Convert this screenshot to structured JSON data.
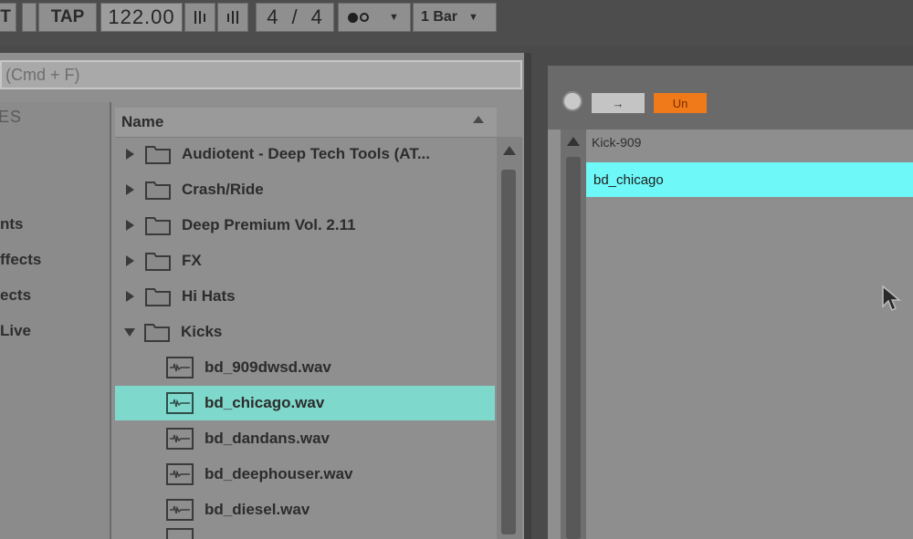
{
  "transport": {
    "first_label": "T",
    "tap_label": "TAP",
    "tempo": "122.00",
    "time_sig_num": "4",
    "time_sig_sep": "/",
    "time_sig_den": "4",
    "quantize": "1 Bar"
  },
  "browser": {
    "search_placeholder": "(Cmd + F)",
    "places": [
      {
        "label": "ES"
      },
      {
        "label": "nts"
      },
      {
        "label": "ffects"
      },
      {
        "label": "ects"
      },
      {
        "label": "Live"
      }
    ],
    "column_header": "Name",
    "rows": [
      {
        "type": "folder",
        "label": "Audiotent - Deep Tech Tools (AT...",
        "expanded": false
      },
      {
        "type": "folder",
        "label": "Crash/Ride",
        "expanded": false
      },
      {
        "type": "folder",
        "label": "Deep Premium Vol. 2.11",
        "expanded": false
      },
      {
        "type": "folder",
        "label": "FX",
        "expanded": false
      },
      {
        "type": "folder",
        "label": "Hi Hats",
        "expanded": false
      },
      {
        "type": "folder",
        "label": "Kicks",
        "expanded": true
      },
      {
        "type": "file",
        "label": "bd_909dwsd.wav",
        "selected": false
      },
      {
        "type": "file",
        "label": "bd_chicago.wav",
        "selected": true
      },
      {
        "type": "file",
        "label": "bd_dandans.wav",
        "selected": false
      },
      {
        "type": "file",
        "label": "bd_deephouser.wav",
        "selected": false
      },
      {
        "type": "file",
        "label": "bd_diesel.wav",
        "selected": false
      }
    ]
  },
  "preview": {
    "grey_button": "→",
    "orange_button": "Un",
    "header": "Kick-909",
    "selected_item": "bd_chicago"
  },
  "colors": {
    "selection_teal": "#7fd8cc",
    "preview_cyan": "#6ff8f8",
    "accent_orange": "#f07a1a"
  }
}
